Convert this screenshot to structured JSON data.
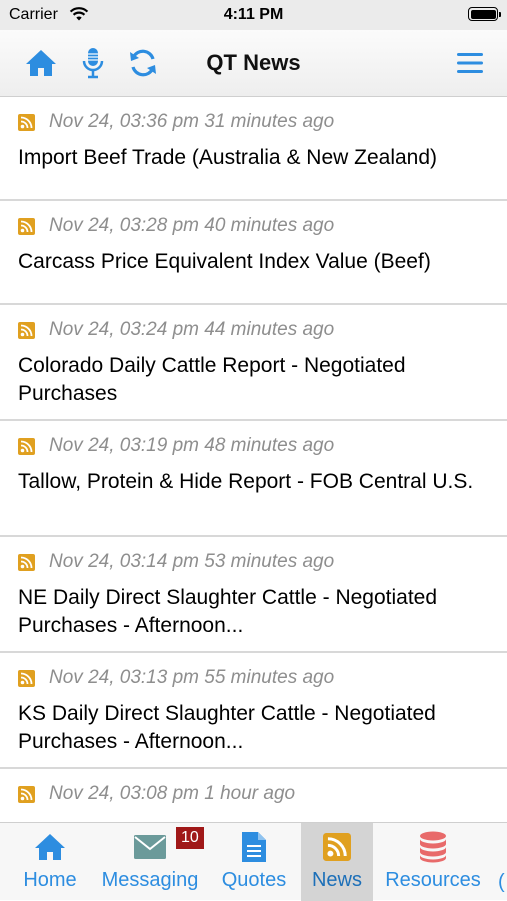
{
  "status_bar": {
    "carrier": "Carrier",
    "time": "4:11 PM"
  },
  "header": {
    "title": "QT News",
    "icons": [
      "home-icon",
      "microphone-icon",
      "refresh-icon",
      "menu-icon"
    ]
  },
  "news": [
    {
      "date": "Nov 24, 03:36 pm 31 minutes ago",
      "title": "Import Beef Trade (Australia & New Zealand)"
    },
    {
      "date": "Nov 24, 03:28 pm 40 minutes ago",
      "title": "Carcass Price Equivalent Index Value (Beef)"
    },
    {
      "date": "Nov 24, 03:24 pm 44 minutes ago",
      "title": "Colorado Daily Cattle Report - Negotiated Purchases"
    },
    {
      "date": "Nov 24, 03:19 pm 48 minutes ago",
      "title": "Tallow, Protein & Hide Report - FOB Central U.S."
    },
    {
      "date": "Nov 24, 03:14 pm 53 minutes ago",
      "title": "NE Daily Direct Slaughter Cattle - Negotiated Purchases - Afternoon..."
    },
    {
      "date": "Nov 24, 03:13 pm 55 minutes ago",
      "title": "KS Daily Direct Slaughter Cattle - Negotiated Purchases - Afternoon..."
    },
    {
      "date": "Nov 24, 03:08 pm 1 hour ago",
      "title": ""
    }
  ],
  "tabs": [
    {
      "label": "Home",
      "icon": "home-icon"
    },
    {
      "label": "Messaging",
      "icon": "envelope-icon",
      "badge": "10"
    },
    {
      "label": "Quotes",
      "icon": "document-icon"
    },
    {
      "label": "News",
      "icon": "rss-icon",
      "active": true
    },
    {
      "label": "Resources",
      "icon": "database-icon"
    }
  ],
  "colors": {
    "accent": "#2d8de0",
    "rss": "#e0a020",
    "badge": "#a01818",
    "resources": "#e86a6a"
  }
}
